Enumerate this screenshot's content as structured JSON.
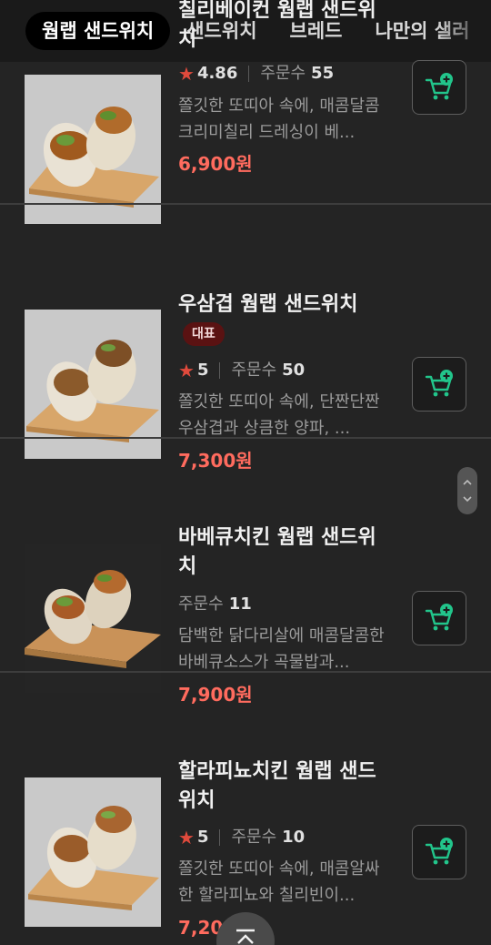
{
  "tabs": [
    {
      "label": "웜랩 샌드위치"
    },
    {
      "label": "샌드위치"
    },
    {
      "label": "브레드"
    },
    {
      "label": "나만의 샐러"
    }
  ],
  "items": [
    {
      "title": "칠리베이컨 웜랩 샌드위치",
      "rating": "4.86",
      "orders_label": "주문수",
      "orders": "55",
      "desc": "쫄깃한 또띠아 속에, 매콤달콤 크리미칠리 드레싱이 베...",
      "price": "6,900원"
    },
    {
      "title": "우삼겹 웜랩 샌드위치",
      "badge": "대표",
      "rating": "5",
      "orders_label": "주문수",
      "orders": "50",
      "desc": "쫄깃한 또띠아 속에, 단짠단짠 우삼겹과 상큼한 양파, ...",
      "price": "7,300원"
    },
    {
      "title": "바베큐치킨 웜랩 샌드위치",
      "orders_label": "주문수",
      "orders": "11",
      "desc": "담백한 닭다리살에 매콤달콤한 바베큐소스가 곡물밥과...",
      "price": "7,900원"
    },
    {
      "title": "할라피뇨치킨 웜랩 샌드위치",
      "rating": "5",
      "orders_label": "주문수",
      "orders": "10",
      "desc": "쫄깃한 또띠아 속에, 매콤알싸한 할라피뇨와 칠리빈이...",
      "price": "7,200원"
    }
  ],
  "icons": {
    "rating": "star-icon",
    "cart": "cart-add-icon",
    "scroll_top": "chevron-up-icon"
  },
  "colors": {
    "price": "#ff6b5e",
    "accent": "#22c58b",
    "badge_bg": "#5a1212"
  }
}
